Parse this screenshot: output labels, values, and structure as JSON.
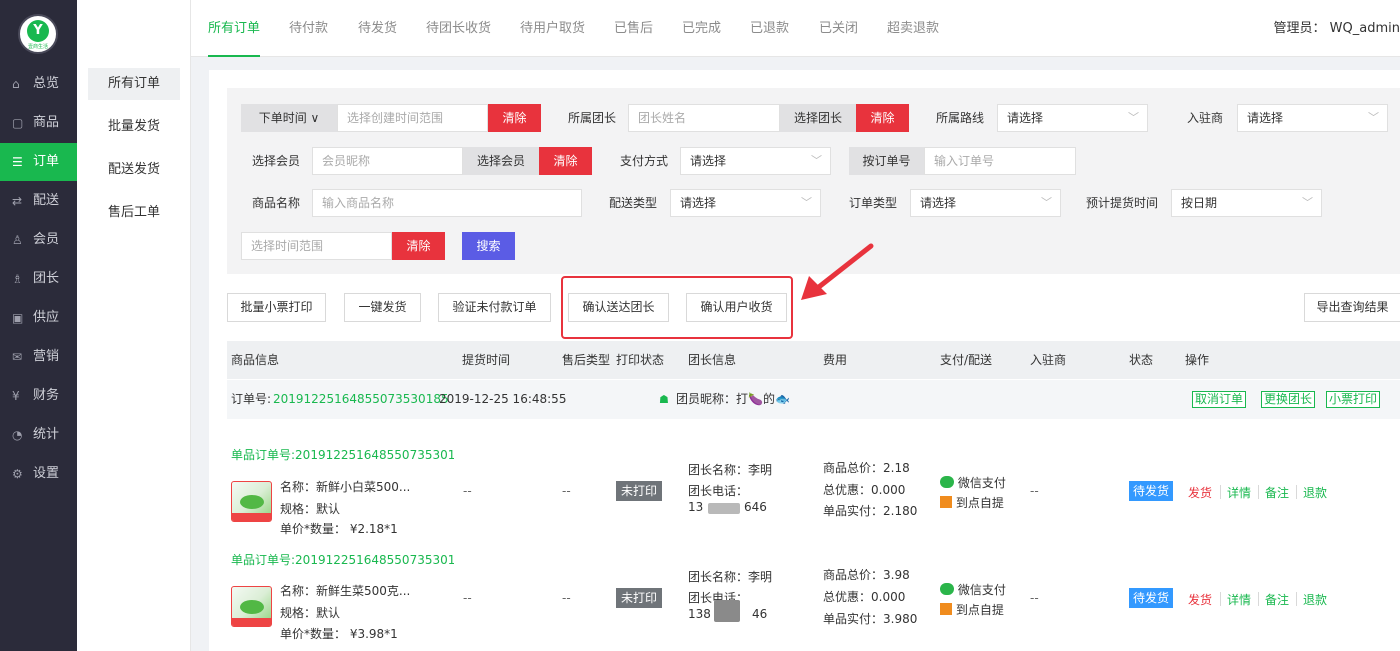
{
  "brand": {
    "logo_letter": "Y",
    "logo_text": "壹商生活"
  },
  "sidebar": {
    "items": [
      {
        "label": "总览",
        "icon": "home-icon",
        "glyph": "⌂"
      },
      {
        "label": "商品",
        "icon": "product-icon",
        "glyph": "▢"
      },
      {
        "label": "订单",
        "icon": "order-icon",
        "glyph": "☰"
      },
      {
        "label": "配送",
        "icon": "delivery-icon",
        "glyph": "⇄"
      },
      {
        "label": "会员",
        "icon": "member-icon",
        "glyph": "♙"
      },
      {
        "label": "团长",
        "icon": "leader-icon",
        "glyph": "♗"
      },
      {
        "label": "供应",
        "icon": "supply-icon",
        "glyph": "▣"
      },
      {
        "label": "营销",
        "icon": "marketing-icon",
        "glyph": "✉"
      },
      {
        "label": "财务",
        "icon": "finance-icon",
        "glyph": "¥"
      },
      {
        "label": "统计",
        "icon": "stats-icon",
        "glyph": "◔"
      },
      {
        "label": "设置",
        "icon": "settings-icon",
        "glyph": "⚙"
      }
    ]
  },
  "submenu": {
    "items": [
      "所有订单",
      "批量发货",
      "配送发货",
      "售后工单"
    ]
  },
  "tabs": [
    "所有订单",
    "待付款",
    "待发货",
    "待团长收货",
    "待用户取货",
    "已售后",
    "已完成",
    "已退款",
    "已关闭",
    "超卖退款"
  ],
  "admin": "管理员： WQ_admin",
  "filters": {
    "time_select": "下单时间 ∨",
    "time_placeholder": "选择创建时间范围",
    "clear": "清除",
    "leader_label": "所属团长",
    "leader_placeholder": "团长姓名",
    "select_leader": "选择团长",
    "route_label": "所属路线",
    "route_value": "请选择",
    "merchant_label": "入驻商",
    "merchant_value": "请选择",
    "member_label": "选择会员",
    "member_placeholder": "会员昵称",
    "select_member": "选择会员",
    "pay_label": "支付方式",
    "pay_value": "请选择",
    "order_no_btn": "按订单号",
    "order_no_placeholder": "输入订单号",
    "product_label": "商品名称",
    "product_placeholder": "输入商品名称",
    "ship_type_label": "配送类型",
    "ship_type_value": "请选择",
    "order_type_label": "订单类型",
    "order_type_value": "请选择",
    "pickup_label": "预计提货时间",
    "pickup_value": "按日期",
    "range_placeholder": "选择时间范围",
    "search": "搜索"
  },
  "actions": {
    "batch_print": "批量小票打印",
    "one_click_ship": "一键发货",
    "verify_unpaid": "验证未付款订单",
    "confirm_to_leader": "确认送达团长",
    "confirm_user_receive": "确认用户收货",
    "export": "导出查询结果"
  },
  "table_headers": [
    "商品信息",
    "提货时间",
    "售后类型",
    "打印状态",
    "团长信息",
    "费用",
    "支付/配送",
    "入驻商",
    "状态",
    "操作"
  ],
  "order": {
    "label": "订单号:",
    "number": "20191225164855073530185",
    "time": "2019-12-25 16:48:55",
    "member_nick": "团员昵称：打🍆的🐟",
    "btn_cancel": "取消订单",
    "btn_change_leader": "更换团长",
    "btn_print": "小票打印"
  },
  "items": [
    {
      "sub_order": "单品订单号:20191225164855073530185",
      "name": "名称：新鲜小白菜500...",
      "spec": "规格：默认",
      "price": "单价*数量： ¥2.18*1",
      "pickup": "--",
      "after_sale": "--",
      "print": "未打印",
      "leader_name": "团长名称：李明",
      "leader_phone_label": "团长电话：",
      "phone_a": "13",
      "phone_b": "646",
      "total": "商品总价：2.18",
      "discount": "总优惠：0.000",
      "paid": "单品实付：2.180",
      "pay": "微信支付",
      "ship": "到点自提",
      "merchant": "--",
      "status": "待发货",
      "ops": [
        "发货",
        "详情",
        "备注",
        "退款"
      ]
    },
    {
      "sub_order": "单品订单号:20191225164855073530185",
      "name": "名称：新鲜生菜500克...",
      "spec": "规格：默认",
      "price": "单价*数量： ¥3.98*1",
      "pickup": "--",
      "after_sale": "--",
      "print": "未打印",
      "leader_name": "团长名称：李明",
      "leader_phone_label": "团长电话：",
      "phone_a": "138",
      "phone_b": "46",
      "total": "商品总价：3.98",
      "discount": "总优惠：0.000",
      "paid": "单品实付：3.980",
      "pay": "微信支付",
      "ship": "到点自提",
      "merchant": "--",
      "status": "待发货",
      "ops": [
        "发货",
        "详情",
        "备注",
        "退款"
      ]
    }
  ],
  "colors": {
    "primary": "#19b84f",
    "danger": "#e8333d",
    "search": "#5b5ce5",
    "status": "#3399ff",
    "sidebar": "#2b2b3a"
  }
}
